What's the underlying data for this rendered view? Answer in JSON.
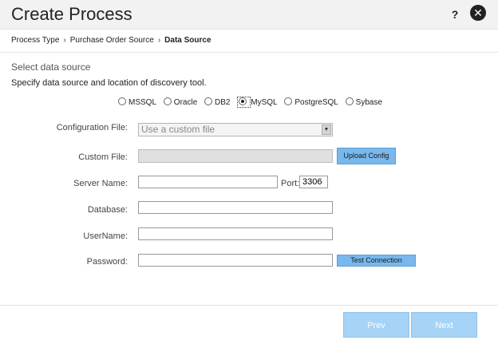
{
  "dialog": {
    "title": "Create Process",
    "help_label": "?",
    "close_label": "✕"
  },
  "breadcrumb": {
    "items": [
      "Process Type",
      "Purchase Order Source",
      "Data Source"
    ],
    "separator": "›"
  },
  "section": {
    "title": "Select data source",
    "instruction": "Specify data source and location of discovery tool."
  },
  "datasource": {
    "options": [
      "MSSQL",
      "Oracle",
      "DB2",
      "MySQL",
      "PostgreSQL",
      "Sybase"
    ],
    "selected": "MySQL"
  },
  "form": {
    "config_file": {
      "label": "Configuration File:",
      "value": "Use a custom file"
    },
    "custom_file": {
      "label": "Custom File:",
      "value": "",
      "button": "Upload Config"
    },
    "server_name": {
      "label": "Server Name:",
      "value": ""
    },
    "port": {
      "label": "Port:",
      "value": "3306"
    },
    "database": {
      "label": "Database:",
      "value": ""
    },
    "username": {
      "label": "UserName:",
      "value": ""
    },
    "password": {
      "label": "Password:",
      "value": "",
      "button": "Test Connection"
    }
  },
  "footer": {
    "prev_label": "Prev",
    "next_label": "Next"
  },
  "colors": {
    "accent_button": "#78b8ec",
    "nav_button": "#a6d3f6"
  }
}
